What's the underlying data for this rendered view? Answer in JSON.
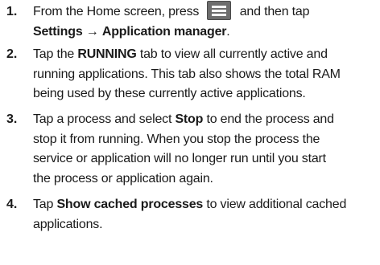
{
  "steps": [
    {
      "number": "1.",
      "lines": [
        {
          "before": "From the Home screen, press",
          "icon": "menu-key-icon",
          "after": "and then tap"
        },
        {
          "bold1": "Settings",
          "arrow": "→",
          "bold2": "Application manager",
          "end": "."
        }
      ]
    },
    {
      "number": "2.",
      "lines": [
        {
          "pre": "Tap the ",
          "bold": "RUNNING",
          "post": " tab to view all currently active and"
        },
        {
          "text": "running applications. This tab also shows the total RAM"
        },
        {
          "text": "being used by these currently active applications."
        }
      ]
    },
    {
      "number": "3.",
      "lines": [
        {
          "pre": "Tap a process and select ",
          "bold": "Stop",
          "post": " to end the process and"
        },
        {
          "text": "stop it from running. When you stop the process the"
        },
        {
          "text": "service or application will no longer run until you start"
        },
        {
          "text": "the process or application again."
        }
      ]
    },
    {
      "number": "4.",
      "lines": [
        {
          "pre": "Tap ",
          "bold": "Show cached processes",
          "post": " to view additional cached"
        },
        {
          "text": "applications."
        }
      ]
    }
  ]
}
